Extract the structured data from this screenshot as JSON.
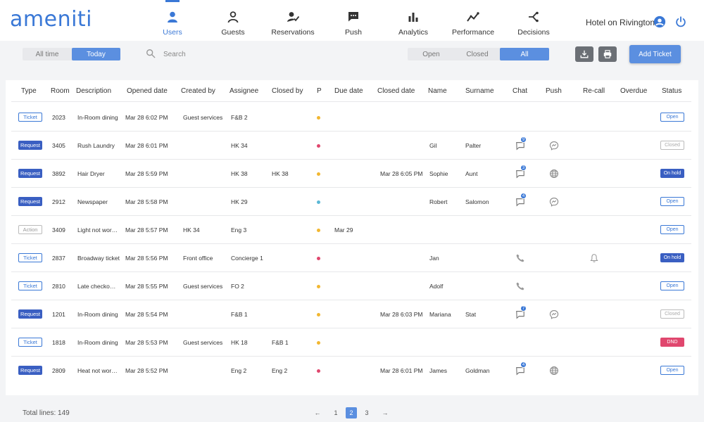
{
  "app": {
    "logo": "ameniti",
    "hotel": "Hotel on Rivington"
  },
  "nav": [
    {
      "label": "Users",
      "icon": "user-icon",
      "active": true
    },
    {
      "label": "Guests",
      "icon": "guest-icon"
    },
    {
      "label": "Reservations",
      "icon": "reservations-icon"
    },
    {
      "label": "Push",
      "icon": "push-icon"
    },
    {
      "label": "Analytics",
      "icon": "analytics-icon"
    },
    {
      "label": "Performance",
      "icon": "performance-icon"
    },
    {
      "label": "Decisions",
      "icon": "decisions-icon"
    }
  ],
  "toolbar": {
    "time_filter": [
      "All time",
      "Today"
    ],
    "time_selected": "Today",
    "search_placeholder": "Search",
    "status_filter": [
      "Open",
      "Closed",
      "All"
    ],
    "status_selected": "All",
    "add_ticket": "Add Ticket"
  },
  "columns": [
    "Type",
    "Room",
    "Description",
    "Opened date",
    "Created by",
    "Assignee",
    "Closed by",
    "P",
    "Due date",
    "Closed date",
    "Name",
    "Surname",
    "Chat",
    "Push",
    "Re-call",
    "Overdue",
    "Status"
  ],
  "colors": {
    "accent": "#3a78d6",
    "priority_yellow": "#f2b731",
    "priority_red": "#e0476e",
    "priority_teal": "#5bb8d6",
    "dnd": "#e0476e"
  },
  "rows": [
    {
      "type": "Ticket",
      "room": "2023",
      "description": "In-Room dining",
      "opened": "Mar 28 6:02 PM",
      "created_by": "Guest services",
      "assignee": "F&B 2",
      "closed_by": "",
      "priority": "yellow",
      "due": "",
      "closed_date": "",
      "name": "",
      "surname": "",
      "chat": null,
      "push": null,
      "recall": false,
      "status": "Open"
    },
    {
      "type": "Request",
      "room": "3405",
      "description": "Rush Laundry",
      "opened": "Mar 28 6:01 PM",
      "created_by": "",
      "assignee": "HK 34",
      "closed_by": "",
      "priority": "red",
      "due": "",
      "closed_date": "",
      "name": "Gil",
      "surname": "Palter",
      "chat": "9",
      "push": "messenger-icon",
      "recall": false,
      "status": "Closed"
    },
    {
      "type": "Request",
      "room": "3892",
      "description": "Hair Dryer",
      "opened": "Mar 28 5:59 PM",
      "created_by": "",
      "assignee": "HK 38",
      "closed_by": "HK 38",
      "priority": "yellow",
      "due": "",
      "closed_date": "Mar 28 6:05 PM",
      "name": "Sophie",
      "surname": "Aunt",
      "chat": "3",
      "push": "globe-icon",
      "recall": false,
      "status": "On hold"
    },
    {
      "type": "Request",
      "room": "2912",
      "description": "Newspaper",
      "opened": "Mar 28 5:58 PM",
      "created_by": "",
      "assignee": "HK 29",
      "closed_by": "",
      "priority": "teal",
      "due": "",
      "closed_date": "",
      "name": "Robert",
      "surname": "Salomon",
      "chat": "4",
      "push": "messenger-icon",
      "recall": false,
      "status": "Open"
    },
    {
      "type": "Action",
      "room": "3409",
      "description": "Light not wor…",
      "opened": "Mar 28 5:57 PM",
      "created_by": "HK 34",
      "assignee": "Eng 3",
      "closed_by": "",
      "priority": "yellow",
      "due": "Mar 29",
      "closed_date": "",
      "name": "",
      "surname": "",
      "chat": null,
      "push": null,
      "recall": false,
      "status": "Open"
    },
    {
      "type": "Ticket",
      "room": "2837",
      "description": "Broadway ticket",
      "opened": "Mar 28 5:56 PM",
      "created_by": "Front office",
      "assignee": "Concierge 1",
      "closed_by": "",
      "priority": "red",
      "due": "",
      "closed_date": "",
      "name": "Jan",
      "surname": "",
      "chat": "phone",
      "push": null,
      "recall": true,
      "status": "On hold"
    },
    {
      "type": "Ticket",
      "room": "2810",
      "description": "Late checko…",
      "opened": "Mar 28 5:55 PM",
      "created_by": "Guest services",
      "assignee": "FO 2",
      "closed_by": "",
      "priority": "yellow",
      "due": "",
      "closed_date": "",
      "name": "Adolf",
      "surname": "",
      "chat": "phone",
      "push": null,
      "recall": false,
      "status": "Open"
    },
    {
      "type": "Request",
      "room": "1201",
      "description": "In-Room dining",
      "opened": "Mar 28 5:54 PM",
      "created_by": "",
      "assignee": "F&B 1",
      "closed_by": "",
      "priority": "yellow",
      "due": "",
      "closed_date": "Mar 28 6:03 PM",
      "name": "Mariana",
      "surname": "Stat",
      "chat": "7",
      "push": "messenger-icon",
      "recall": false,
      "status": "Closed"
    },
    {
      "type": "Ticket",
      "room": "1818",
      "description": "In-Room dining",
      "opened": "Mar 28 5:53 PM",
      "created_by": "Guest services",
      "assignee": "HK 18",
      "closed_by": "F&B 1",
      "priority": "yellow",
      "due": "",
      "closed_date": "",
      "name": "",
      "surname": "",
      "chat": null,
      "push": null,
      "recall": false,
      "status": "DND"
    },
    {
      "type": "Request",
      "room": "2809",
      "description": "Heat not wor…",
      "opened": "Mar 28 5:52 PM",
      "created_by": "",
      "assignee": "Eng 2",
      "closed_by": "Eng 2",
      "priority": "red",
      "due": "",
      "closed_date": "Mar 28 6:01 PM",
      "name": "James",
      "surname": "Goldman",
      "chat": "4",
      "push": "globe-icon",
      "recall": false,
      "status": "Open"
    }
  ],
  "footer": {
    "total": "Total lines: 149",
    "pages": [
      "1",
      "2",
      "3"
    ],
    "current_page": "2",
    "prev": "←",
    "next": "→"
  }
}
